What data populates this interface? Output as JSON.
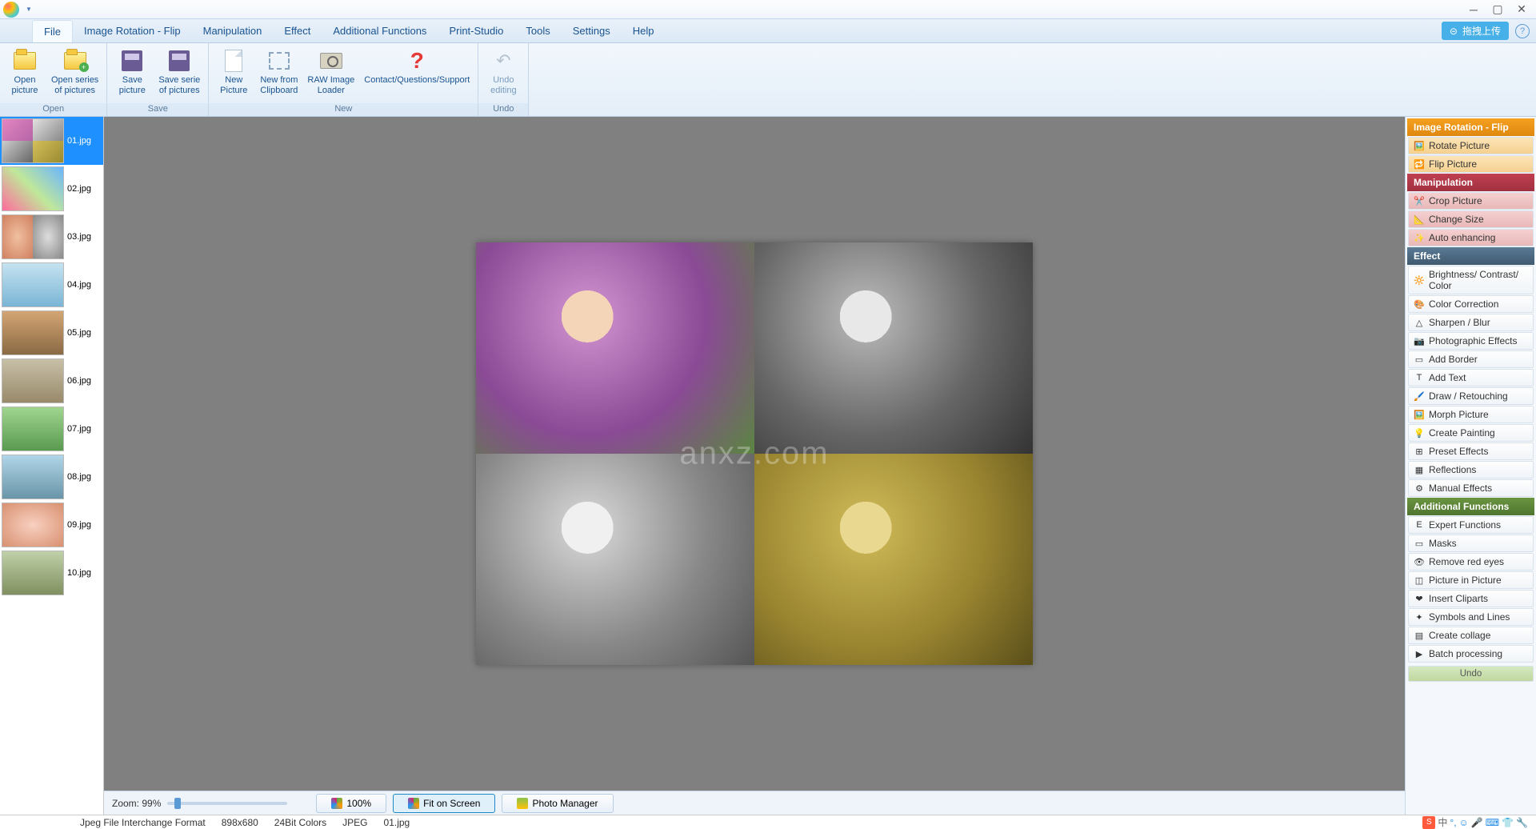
{
  "titlebar": {
    "upload_label": "拖拽上传"
  },
  "menu": {
    "items": [
      "File",
      "Image Rotation - Flip",
      "Manipulation",
      "Effect",
      "Additional Functions",
      "Print-Studio",
      "Tools",
      "Settings",
      "Help"
    ],
    "active_index": 0
  },
  "ribbon": {
    "groups": [
      {
        "label": "Open",
        "buttons": [
          {
            "label": "Open\npicture",
            "icon": "folder"
          },
          {
            "label": "Open series\nof pictures",
            "icon": "folder-plus"
          }
        ]
      },
      {
        "label": "Save",
        "buttons": [
          {
            "label": "Save\npicture",
            "icon": "floppy"
          },
          {
            "label": "Save serie\nof pictures",
            "icon": "floppy-multi"
          }
        ]
      },
      {
        "label": "New",
        "buttons": [
          {
            "label": "New\nPicture",
            "icon": "page"
          },
          {
            "label": "New from\nClipboard",
            "icon": "clipboard"
          },
          {
            "label": "RAW Image\nLoader",
            "icon": "camera"
          },
          {
            "label": "Contact/Questions/Support",
            "icon": "question"
          }
        ]
      },
      {
        "label": "Undo",
        "buttons": [
          {
            "label": "Undo\nediting",
            "icon": "undo",
            "disabled": true
          }
        ]
      }
    ]
  },
  "thumbnails": [
    {
      "label": "01.jpg",
      "selected": true,
      "style": "quad4"
    },
    {
      "label": "02.jpg",
      "style": "birthday"
    },
    {
      "label": "03.jpg",
      "style": "face-split"
    },
    {
      "label": "04.jpg",
      "style": "sky-objects"
    },
    {
      "label": "05.jpg",
      "style": "canyon"
    },
    {
      "label": "06.jpg",
      "style": "beach"
    },
    {
      "label": "07.jpg",
      "style": "elephant"
    },
    {
      "label": "08.jpg",
      "style": "text-cloud"
    },
    {
      "label": "09.jpg",
      "style": "badge-face"
    },
    {
      "label": "10.jpg",
      "style": "green"
    }
  ],
  "canvas": {
    "watermark": "anxz.com"
  },
  "zoombar": {
    "zoom_label": "Zoom: 99%",
    "btn_100": "100%",
    "btn_fit": "Fit on Screen",
    "btn_photo_manager": "Photo Manager"
  },
  "sidepanel": {
    "sections": [
      {
        "header": "Image Rotation - Flip",
        "color": "orange",
        "item_class": "orange-bg",
        "items": [
          {
            "label": "Rotate Picture",
            "icon": "🖼️"
          },
          {
            "label": "Flip Picture",
            "icon": "🔁"
          }
        ]
      },
      {
        "header": "Manipulation",
        "color": "red",
        "item_class": "red-bg",
        "items": [
          {
            "label": "Crop Picture",
            "icon": "✂️"
          },
          {
            "label": "Change Size",
            "icon": "📐"
          },
          {
            "label": "Auto enhancing",
            "icon": "✨"
          }
        ]
      },
      {
        "header": "Effect",
        "color": "blue",
        "item_class": "",
        "items": [
          {
            "label": "Brightness/ Contrast/ Color",
            "icon": "🔆"
          },
          {
            "label": "Color Correction",
            "icon": "🎨"
          },
          {
            "label": "Sharpen / Blur",
            "icon": "△"
          },
          {
            "label": "Photographic Effects",
            "icon": "📷"
          },
          {
            "label": "Add Border",
            "icon": "▭"
          },
          {
            "label": "Add Text",
            "icon": "T"
          },
          {
            "label": "Draw / Retouching",
            "icon": "🖌️"
          },
          {
            "label": "Morph Picture",
            "icon": "🖼️"
          },
          {
            "label": "Create Painting",
            "icon": "💡"
          },
          {
            "label": "Preset Effects",
            "icon": "⊞"
          },
          {
            "label": "Reflections",
            "icon": "▦"
          },
          {
            "label": "Manual Effects",
            "icon": "⚙"
          }
        ]
      },
      {
        "header": "Additional Functions",
        "color": "green",
        "item_class": "",
        "items": [
          {
            "label": "Expert Functions",
            "icon": "E"
          },
          {
            "label": "Masks",
            "icon": "▭"
          },
          {
            "label": "Remove red eyes",
            "icon": "👁"
          },
          {
            "label": "Picture in Picture",
            "icon": "◫"
          },
          {
            "label": "Insert Cliparts",
            "icon": "❤"
          },
          {
            "label": "Symbols and Lines",
            "icon": "✦"
          },
          {
            "label": "Create collage",
            "icon": "▤"
          },
          {
            "label": "Batch processing",
            "icon": "▶"
          }
        ]
      }
    ],
    "undo_label": "Undo"
  },
  "statusbar": {
    "format": "Jpeg File Interchange Format",
    "dimensions": "898x680",
    "colors": "24Bit Colors",
    "codec": "JPEG",
    "filename": "01.jpg",
    "ime": "中"
  }
}
